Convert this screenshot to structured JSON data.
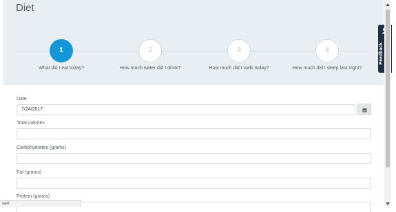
{
  "header": {
    "title": "Diet"
  },
  "steps": [
    {
      "number": "1",
      "label": "What did I eat today?",
      "active": true
    },
    {
      "number": "2",
      "label": "How much water did I drink?",
      "active": false
    },
    {
      "number": "3",
      "label": "How much did I walk today?",
      "active": false
    },
    {
      "number": "4",
      "label": "How much did I sleep last night?",
      "active": false
    }
  ],
  "form": {
    "date_label": "Date",
    "date_value": "7/24/2017",
    "calendar_icon": "calendar-icon",
    "calories_label": "Total calories",
    "calories_value": "",
    "carbs_label": "Carbohydrates (grams)",
    "carbs_value": "",
    "fat_label": "Fat (grams)",
    "fat_value": "",
    "protein_label": "Protein (grams)",
    "protein_value": ""
  },
  "feedback": {
    "label": "Feedback",
    "icon": "user-chat-icon"
  },
  "status_bar": {
    "text": "sse#"
  },
  "colors": {
    "accent": "#1596d8",
    "header_bg": "#e8eef2",
    "feedback_bg": "#1f2f45"
  }
}
